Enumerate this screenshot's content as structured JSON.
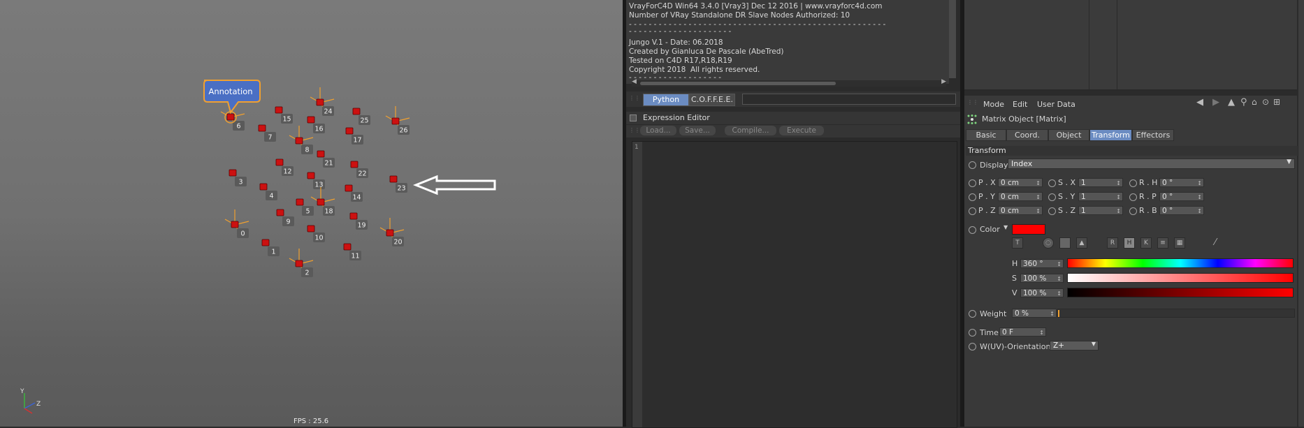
{
  "viewport": {
    "annotation_label": "Annotation",
    "fps": "FPS : 25.6",
    "axis": {
      "y": "Y",
      "z": "Z"
    },
    "points": [
      {
        "id": "0"
      },
      {
        "id": "1"
      },
      {
        "id": "2"
      },
      {
        "id": "3"
      },
      {
        "id": "4"
      },
      {
        "id": "5"
      },
      {
        "id": "6"
      },
      {
        "id": "7"
      },
      {
        "id": "8"
      },
      {
        "id": "9"
      },
      {
        "id": "10"
      },
      {
        "id": "11"
      },
      {
        "id": "12"
      },
      {
        "id": "13"
      },
      {
        "id": "14"
      },
      {
        "id": "15"
      },
      {
        "id": "16"
      },
      {
        "id": "17"
      },
      {
        "id": "18"
      },
      {
        "id": "19"
      },
      {
        "id": "20"
      },
      {
        "id": "21"
      },
      {
        "id": "22"
      },
      {
        "id": "23"
      },
      {
        "id": "24"
      },
      {
        "id": "25"
      },
      {
        "id": "26"
      }
    ]
  },
  "console": {
    "lines": [
      "VrayForC4D Win64 3.4.0 [Vray3] Dec 12 2016 | www.vrayforc4d.com",
      "Number of VRay Standalone DR Slave Nodes Authorized: 10",
      "- - - - - - - - - - - - - - - - - - - - - - - - - - - - - - - - - - - - - - - - - - - - - - - - - - - -",
      "- - - - - - - - - - - - - - - - - - - - -",
      "Jungo V.1 - Date: 06.2018",
      "Created by Gianluca De Pascale (AbeTred)",
      "Tested on C4D R17,R18,R19",
      "Copyright 2018  All rights reserved.",
      "- - - - - - - - - - - - - - - - - - -"
    ]
  },
  "lang_bar": {
    "python": "Python",
    "coffee": "C.O.F.F.E.E."
  },
  "expression_editor": {
    "title": "Expression Editor",
    "load": "Load...",
    "save": "Save...",
    "compile": "Compile...",
    "execute": "Execute",
    "line_number": "1"
  },
  "attributes": {
    "menu": {
      "mode": "Mode",
      "edit": "Edit",
      "user_data": "User Data"
    },
    "object_title": "Matrix Object [Matrix]",
    "tabs": [
      {
        "label": "Basic"
      },
      {
        "label": "Coord."
      },
      {
        "label": "Object"
      },
      {
        "label": "Transform"
      },
      {
        "label": "Effectors"
      }
    ],
    "section": "Transform",
    "display": {
      "label": "Display",
      "value": "Index"
    },
    "px": {
      "label": "P . X",
      "value": "0 cm"
    },
    "py": {
      "label": "P . Y",
      "value": "0 cm"
    },
    "pz": {
      "label": "P . Z",
      "value": "0 cm"
    },
    "sx": {
      "label": "S . X",
      "value": "1"
    },
    "sy": {
      "label": "S . Y",
      "value": "1"
    },
    "sz": {
      "label": "S . Z",
      "value": "1"
    },
    "rh": {
      "label": "R . H",
      "value": "0 °"
    },
    "rp": {
      "label": "R . P",
      "value": "0 °"
    },
    "rb": {
      "label": "R . B",
      "value": "0 °"
    },
    "color": {
      "label": "Color",
      "swatch": "#ff0000"
    },
    "h": {
      "label": "H",
      "value": "360 °"
    },
    "s": {
      "label": "S",
      "value": "100 %"
    },
    "v": {
      "label": "V",
      "value": "100 %"
    },
    "weight": {
      "label": "Weight",
      "value": "0 %"
    },
    "time": {
      "label": "Time",
      "value": "0 F"
    },
    "uv_orientation": {
      "label": "W(UV)-Orientation",
      "value": "Z+"
    }
  },
  "colors": {
    "accent": "#6b8cc2",
    "point": "#cc1111",
    "handle": "#f0a030",
    "annotation": "#4a6fc4"
  }
}
